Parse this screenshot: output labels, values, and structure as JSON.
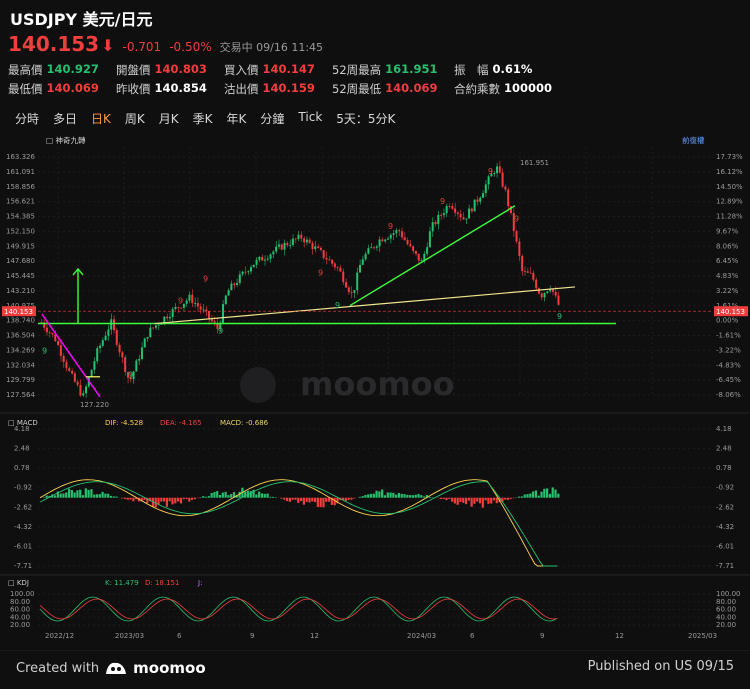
{
  "header": {
    "symbol": "USDJPY 美元/日元"
  },
  "quote": {
    "price": "140.153",
    "arrow": "⬇",
    "change": "-0.701",
    "change_pct": "-0.50%",
    "status": "交易中 09/16 11:45"
  },
  "stats": [
    [
      {
        "label": "最高價",
        "value": "140.927",
        "color": "g"
      },
      {
        "label": "開盤價",
        "value": "140.803",
        "color": "r"
      },
      {
        "label": "買入價",
        "value": "140.147",
        "color": "r"
      },
      {
        "label": "52周最高",
        "value": "161.951",
        "color": "g"
      },
      {
        "label": "振　幅",
        "value": "0.61%",
        "color": "w"
      }
    ],
    [
      {
        "label": "最低價",
        "value": "140.069",
        "color": "r"
      },
      {
        "label": "昨收價",
        "value": "140.854",
        "color": "w"
      },
      {
        "label": "沽出價",
        "value": "140.159",
        "color": "r"
      },
      {
        "label": "52周最低",
        "value": "140.069",
        "color": "r"
      },
      {
        "label": "合約乘數",
        "value": "100000",
        "color": "w"
      }
    ]
  ],
  "tabs": [
    "分時",
    "多日",
    "日K",
    "周K",
    "月K",
    "季K",
    "年K",
    "分鐘",
    "Tick",
    "5天：5分K"
  ],
  "active_tab": "日K",
  "main_chart": {
    "indicator_label": "神奇九轉",
    "adjust_label": "前復權",
    "left_axis": [
      "163.326",
      "161.091",
      "158.856",
      "156.621",
      "154.385",
      "152.150",
      "149.915",
      "147.680",
      "145.445",
      "143.210",
      "140.975",
      "138.740",
      "136.504",
      "134.269",
      "132.034",
      "129.799",
      "127.564"
    ],
    "right_axis": [
      "17.73%",
      "16.12%",
      "14.50%",
      "12.89%",
      "11.28%",
      "9.67%",
      "8.06%",
      "6.45%",
      "4.83%",
      "3.22%",
      "1.61%",
      "0.00%",
      "-1.61%",
      "-3.22%",
      "-4.83%",
      "-6.45%",
      "-8.06%"
    ],
    "last_price_tag": "140.153",
    "high_label": "161.951",
    "low_label": "127.220",
    "watermark": "moomoo"
  },
  "macd": {
    "name": "MACD",
    "dif": "DIF: -4.528",
    "dea": "DEA: -4.165",
    "macd": "MACD: -0.686",
    "left_axis": [
      "4.18",
      "2.48",
      "0.78",
      "-0.92",
      "-2.62",
      "-4.32",
      "-6.01",
      "-7.71"
    ],
    "right_axis": [
      "4.18",
      "2.48",
      "0.78",
      "-0.92",
      "-2.62",
      "-4.32",
      "-6.01",
      "-7.71"
    ]
  },
  "kdj": {
    "name": "KDJ",
    "k": "K: 11.479",
    "d": "D: 18.151",
    "j": "J:",
    "left_axis": [
      "100.00",
      "80.00",
      "60.00",
      "40.00",
      "20.00"
    ],
    "right_axis": [
      "100.00",
      "80.00",
      "60.00",
      "40.00",
      "20.00"
    ]
  },
  "x_axis": [
    "2022/12",
    "2023/03",
    "6",
    "9",
    "12",
    "2024/03",
    "6",
    "9",
    "12",
    "2025/03"
  ],
  "footer": {
    "created_with": "Created with",
    "brand": "moomoo",
    "published": "Published on US 09/15"
  },
  "colors": {
    "up": "#25c16f",
    "down": "#f23d3d",
    "accent": "#ff9a3c",
    "trend_green": "#3cff3c",
    "trend_yellow": "#f0e68c",
    "magenta": "#ff00ff"
  }
}
